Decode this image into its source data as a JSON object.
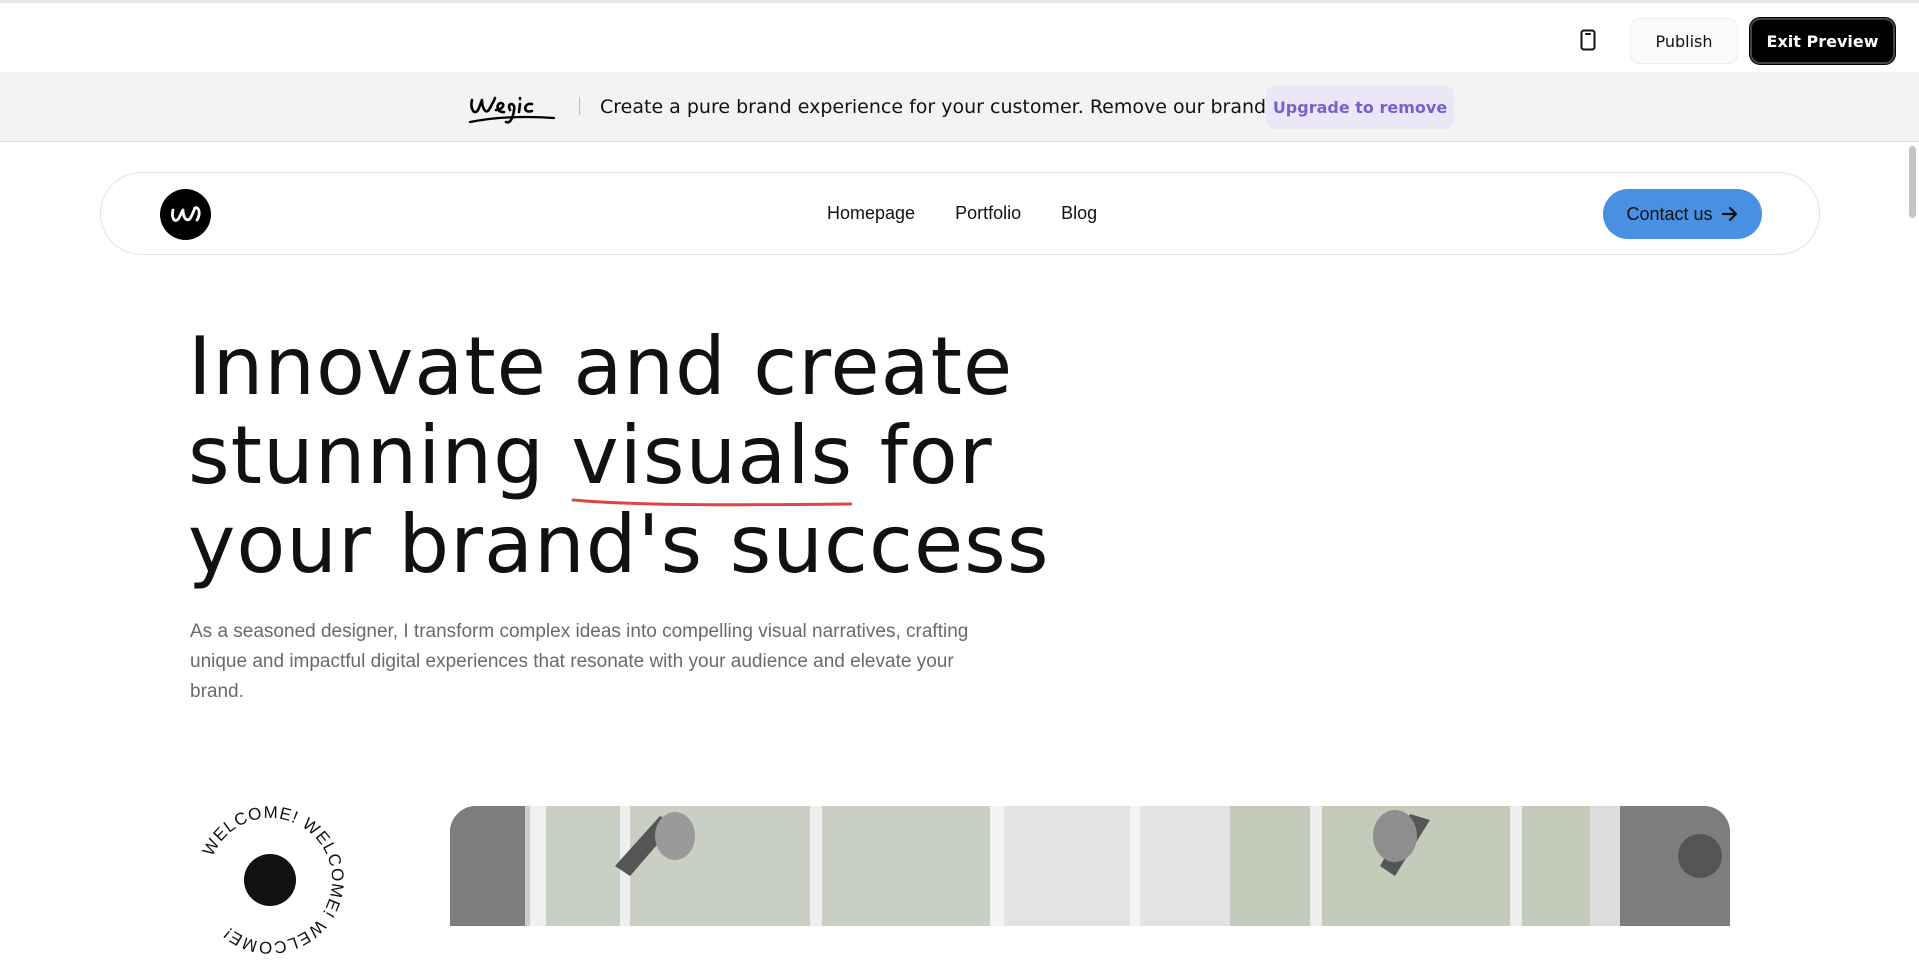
{
  "topbar": {
    "device_icon": "mobile-device-icon",
    "publish_label": "Publish",
    "exit_preview_label": "Exit Preview"
  },
  "banner": {
    "logo_text": "wegic",
    "message": "Create a pure brand experience for your customer. Remove our branding.",
    "upgrade_label": "Upgrade to remove"
  },
  "nav": {
    "logo_icon": "brand-logo-icon",
    "links": [
      "Homepage",
      "Portfolio",
      "Blog"
    ],
    "contact_label": "Contact us",
    "contact_icon": "arrow-right-icon"
  },
  "hero": {
    "title_line1": "Innovate and create",
    "title_line2_before": "stunning ",
    "title_line2_highlight": "visuals",
    "title_line2_after": " for",
    "title_line3": "your brand's success",
    "underline_color": "#e04545",
    "description": "As a seasoned designer, I transform complex ideas into compelling visual narratives, crafting unique and impactful digital experiences that resonate with your audience and elevate your brand.",
    "badge_text": "WELCOME! WELCOME! WELCOME! "
  },
  "colors": {
    "accent_blue": "#4a90e2",
    "upgrade_purple": "#7a5fd0",
    "upgrade_bg": "#ebe7f6"
  }
}
